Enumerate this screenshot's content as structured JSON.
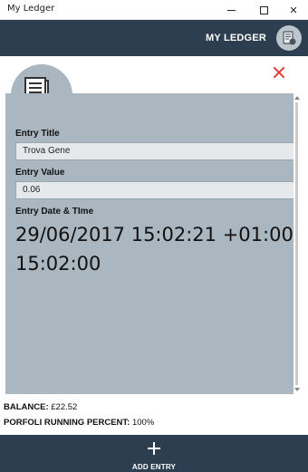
{
  "window": {
    "title": "My Ledger"
  },
  "header": {
    "app_name": "MY LEDGER",
    "avatar_icon": "ledger-avatar-icon"
  },
  "entry": {
    "title_label": "Entry Title",
    "title_value": "Trova Gene",
    "value_label": "Entry Value",
    "value_value": "0.06",
    "datetime_label": "Entry Date & TIme",
    "date_line": "29/06/2017 15:02:21 +01:00",
    "time_line": "15:02:00"
  },
  "status": {
    "balance_label": "BALANCE:",
    "balance_value": "£22.52",
    "percent_label": "PORFOLI RUNNING PERCENT:",
    "percent_value": "100%"
  },
  "footer": {
    "add_label": "ADD ENTRY"
  },
  "colors": {
    "header_bg": "#2c3e50",
    "panel_bg": "#aab7c0",
    "close_red": "#e53935",
    "money_green": "#2e7d6a"
  }
}
